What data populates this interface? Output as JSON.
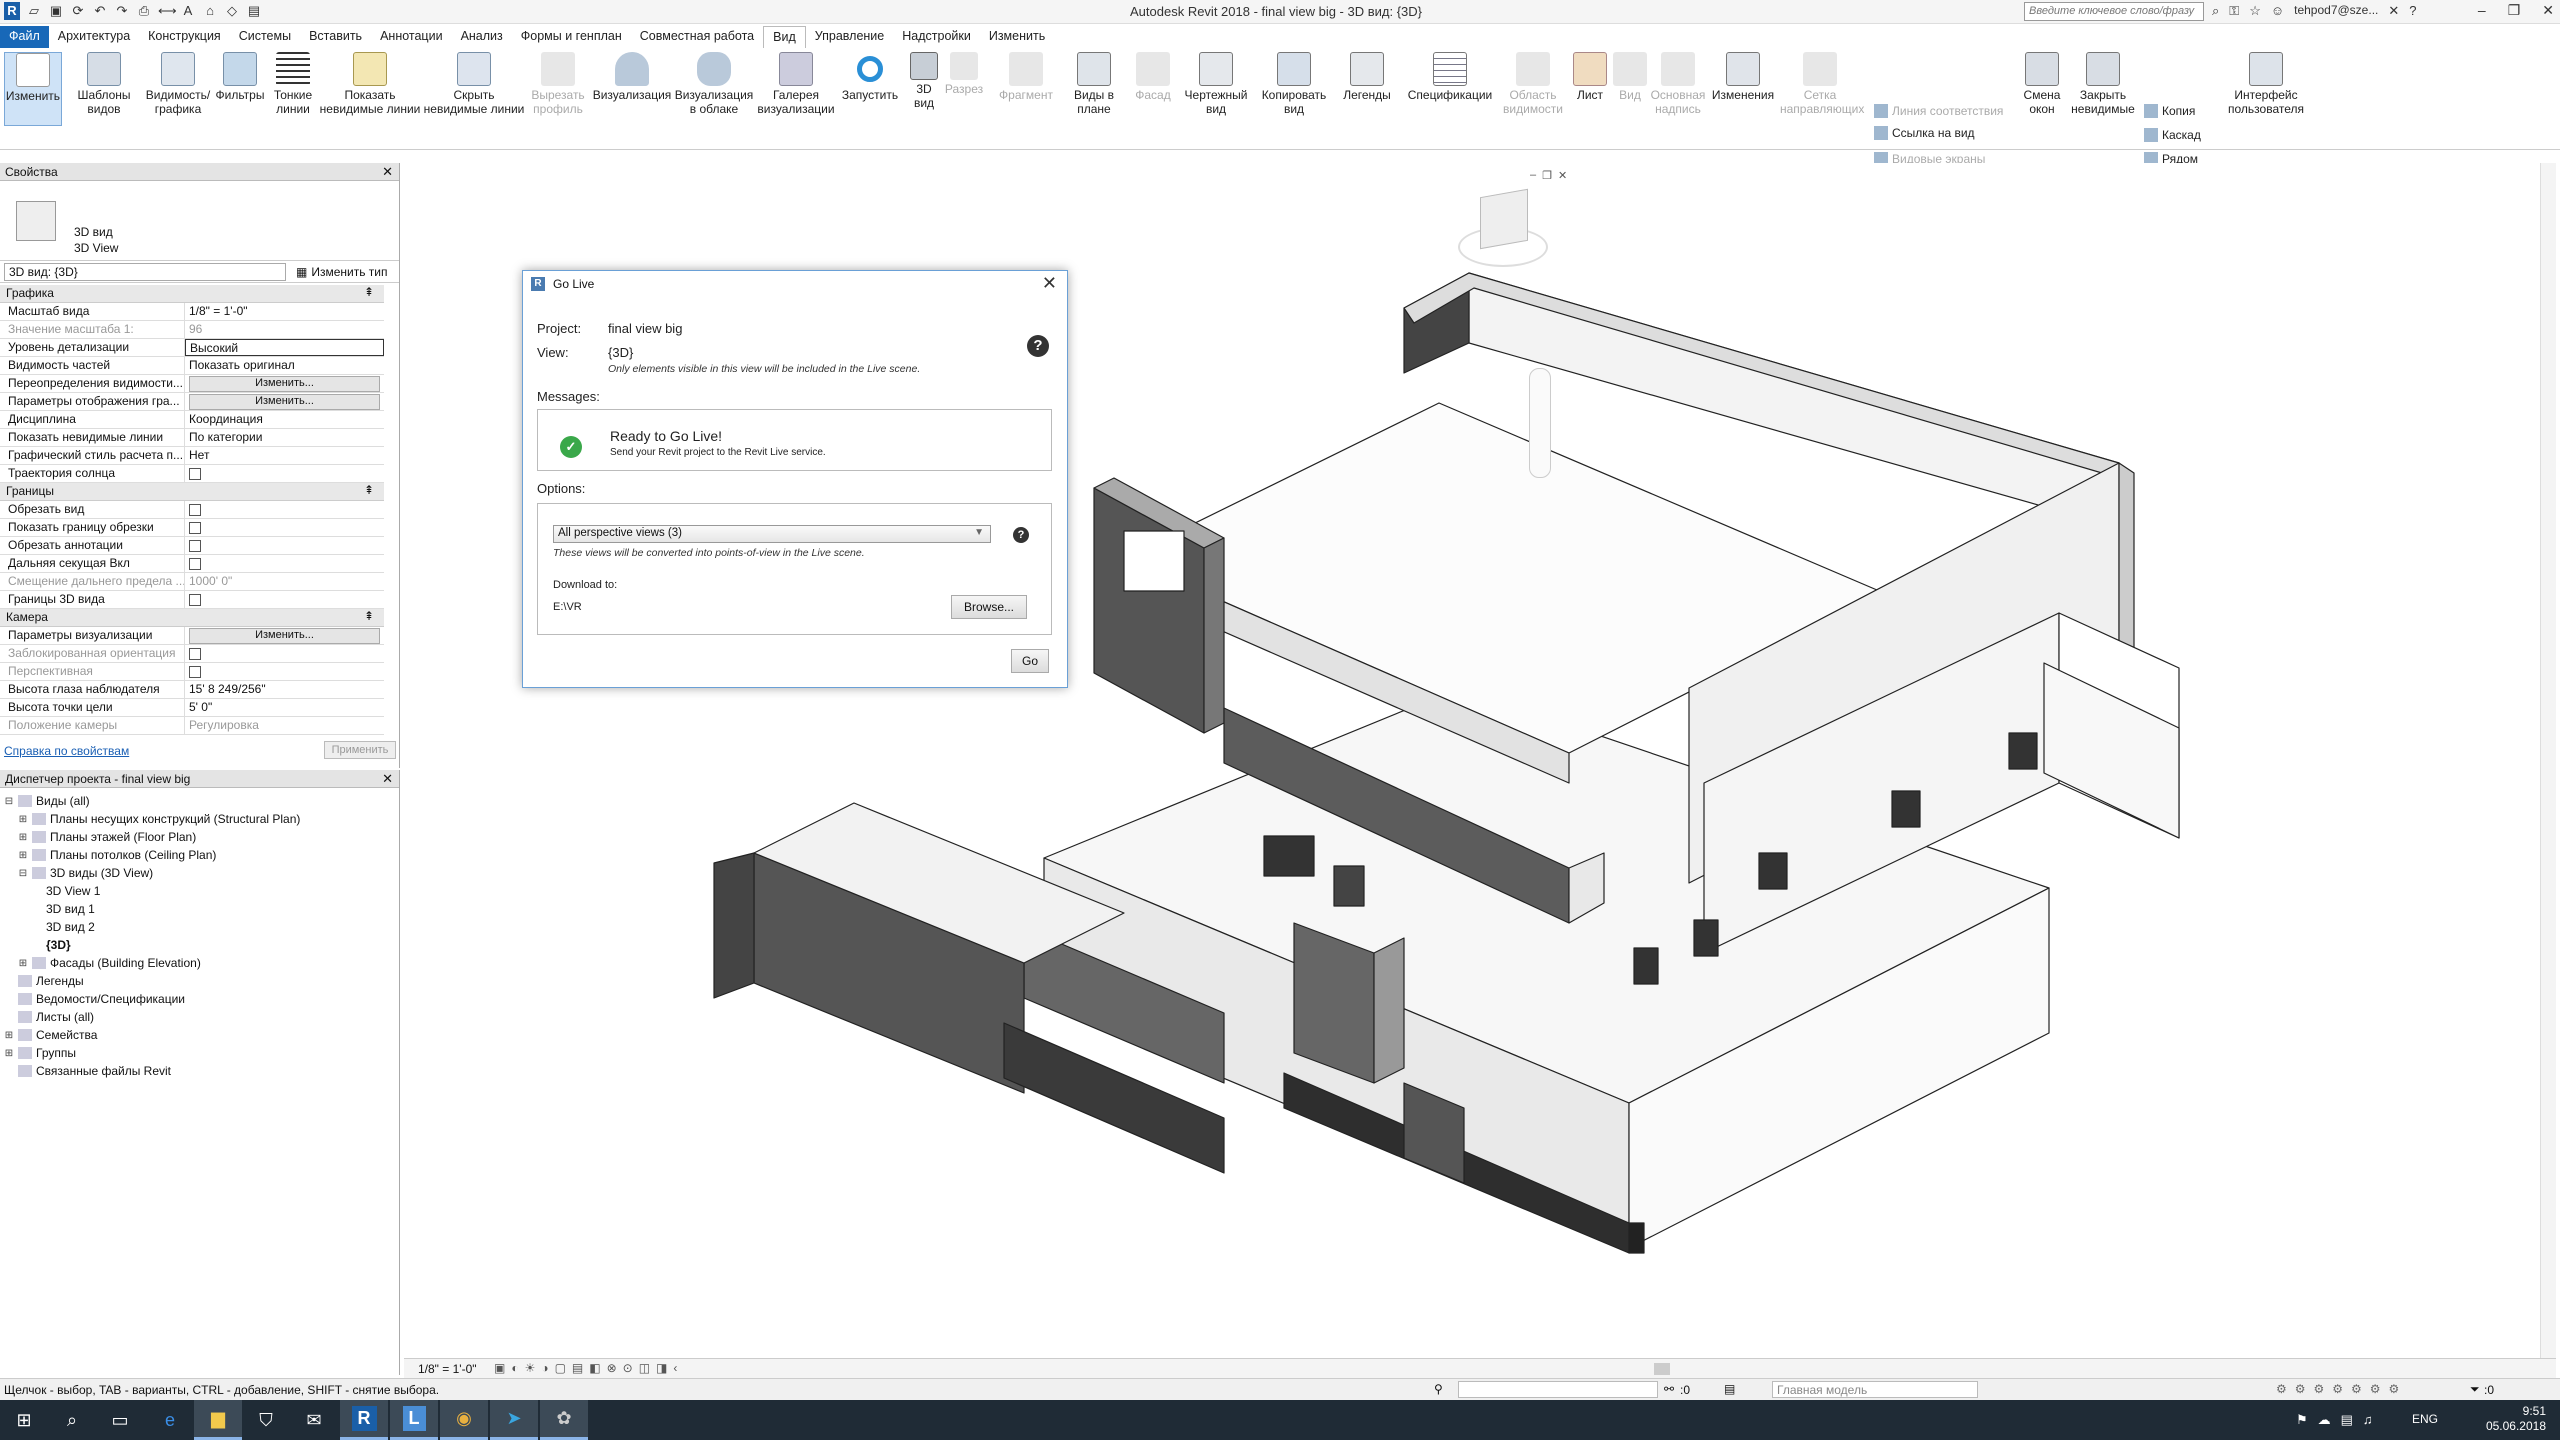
{
  "titlebar": {
    "title": "Autodesk Revit 2018 -   final view big - 3D вид: {3D}",
    "search_placeholder": "Введите ключевое слово/фразу",
    "user": "tehpod7@sze...",
    "qat_icons": [
      "revit-logo-icon",
      "open-icon",
      "save-icon",
      "sync-icon",
      "undo-icon",
      "redo-icon",
      "print-icon",
      "measure-icon",
      "text-icon",
      "3d-view-icon",
      "section-icon",
      "close-hidden-icon"
    ]
  },
  "menu": {
    "tabs": [
      "Файл",
      "Архитектура",
      "Конструкция",
      "Системы",
      "Вставить",
      "Аннотации",
      "Анализ",
      "Формы и генплан",
      "Совместная работа",
      "Вид",
      "Управление",
      "Надстройки",
      "Изменить"
    ],
    "active": "Вид"
  },
  "ribbon": {
    "modify": "Изменить",
    "templates": "Шаблоны видов",
    "visibility": "Видимость/ графика",
    "filters": "Фильтры",
    "thin_lines": "Тонкие линии",
    "show_hidden": "Показать невидимые линии",
    "hide_hidden": "Скрыть невидимые линии",
    "cut_profile": "Вырезать профиль",
    "render": "Визуализация",
    "render_cloud": "Визуализация в облаке",
    "render_gallery": "Галерея визуализации",
    "start": "Запустить",
    "view3d": "3D вид",
    "section": "Разрез",
    "fragment": "Фрагмент",
    "plan_views": "Виды в плане",
    "elevation": "Фасад",
    "drafting": "Чертежный вид",
    "duplicate": "Копировать вид",
    "legends": "Легенды",
    "schedules": "Спецификации",
    "scope_box": "Область видимости",
    "sheet": "Лист",
    "view": "Вид",
    "title_block": "Основная надпись",
    "revisions": "Изменения",
    "guide_grid": "Сетка направляющих",
    "match_line": "Линия соответствия",
    "view_ref": "Ссылка на вид",
    "viewports": "Видовые экраны",
    "switch_windows": "Смена окон",
    "close_hidden": "Закрыть невидимые",
    "copy": "Копия",
    "cascade": "Каскад",
    "tile": "Рядом",
    "ui": "Интерфейс пользователя"
  },
  "properties": {
    "header": "Свойства",
    "type_name1": "3D вид",
    "type_name2": "3D View",
    "type_select": "3D вид: {3D}",
    "edit_type": "Изменить тип",
    "groups": [
      {
        "name": "Графика",
        "rows": [
          {
            "k": "Масштаб вида",
            "v": "1/8\" = 1'-0\"",
            "t": "text"
          },
          {
            "k": "Значение масштаба    1:",
            "v": "96",
            "t": "text",
            "dis": true
          },
          {
            "k": "Уровень детализации",
            "v": "Высокий",
            "t": "text"
          },
          {
            "k": "Видимость частей",
            "v": "Показать оригинал",
            "t": "text"
          },
          {
            "k": "Переопределения видимости...",
            "v": "Изменить...",
            "t": "btn"
          },
          {
            "k": "Параметры отображения гра...",
            "v": "Изменить...",
            "t": "btn"
          },
          {
            "k": "Дисциплина",
            "v": "Координация",
            "t": "text"
          },
          {
            "k": "Показать невидимые линии",
            "v": "По категории",
            "t": "text"
          },
          {
            "k": "Графический стиль расчета п...",
            "v": "Нет",
            "t": "text"
          },
          {
            "k": "Траектория солнца",
            "v": "",
            "t": "cb"
          }
        ]
      },
      {
        "name": "Границы",
        "rows": [
          {
            "k": "Обрезать вид",
            "v": "",
            "t": "cb"
          },
          {
            "k": "Показать границу обрезки",
            "v": "",
            "t": "cb"
          },
          {
            "k": "Обрезать аннотации",
            "v": "",
            "t": "cb"
          },
          {
            "k": "Дальняя секущая Вкл",
            "v": "",
            "t": "cb"
          },
          {
            "k": "Смещение дальнего предела ...",
            "v": "1000'  0\"",
            "t": "text",
            "dis": true
          },
          {
            "k": "Границы 3D вида",
            "v": "",
            "t": "cb"
          }
        ]
      },
      {
        "name": "Камера",
        "rows": [
          {
            "k": "Параметры визуализации",
            "v": "Изменить...",
            "t": "btn"
          },
          {
            "k": "Заблокированная ориентация",
            "v": "",
            "t": "cb",
            "dis": true
          },
          {
            "k": "Перспективная",
            "v": "",
            "t": "cb",
            "dis": true
          },
          {
            "k": "Высота глаза наблюдателя",
            "v": "15'  8 249/256\"",
            "t": "text"
          },
          {
            "k": "Высота точки цели",
            "v": "5'  0\"",
            "t": "text"
          },
          {
            "k": "Положение камеры",
            "v": "Регулировка",
            "t": "text",
            "dis": true
          }
        ]
      }
    ],
    "help_link": "Справка по свойствам",
    "apply": "Применить"
  },
  "browser": {
    "header": "Диспетчер проекта - final view big",
    "nodes": [
      {
        "label": "Виды (all)",
        "depth": 0,
        "tg": "⊟"
      },
      {
        "label": "Планы несущих конструкций (Structural Plan)",
        "depth": 1,
        "tg": "⊞"
      },
      {
        "label": "Планы этажей (Floor Plan)",
        "depth": 1,
        "tg": "⊞"
      },
      {
        "label": "Планы потолков (Ceiling Plan)",
        "depth": 1,
        "tg": "⊞"
      },
      {
        "label": "3D виды (3D View)",
        "depth": 1,
        "tg": "⊟"
      },
      {
        "label": "3D View 1",
        "depth": 2,
        "tg": ""
      },
      {
        "label": "3D вид 1",
        "depth": 2,
        "tg": ""
      },
      {
        "label": "3D вид 2",
        "depth": 2,
        "tg": ""
      },
      {
        "label": "{3D}",
        "depth": 2,
        "tg": "",
        "bold": true
      },
      {
        "label": "Фасады (Building Elevation)",
        "depth": 1,
        "tg": "⊞"
      },
      {
        "label": "Легенды",
        "depth": 0,
        "tg": ""
      },
      {
        "label": "Ведомости/Спецификации",
        "depth": 0,
        "tg": ""
      },
      {
        "label": "Листы (all)",
        "depth": 0,
        "tg": ""
      },
      {
        "label": "Семейства",
        "depth": 0,
        "tg": "⊞"
      },
      {
        "label": "Группы",
        "depth": 0,
        "tg": "⊞"
      },
      {
        "label": "Связанные файлы Revit",
        "depth": 0,
        "tg": ""
      }
    ]
  },
  "dialog": {
    "title": "Go Live",
    "project_label": "Project:",
    "project_value": "final view big",
    "view_label": "View:",
    "view_value": "{3D}",
    "view_note": "Only elements visible in this view will be included in the Live scene.",
    "messages_label": "Messages:",
    "status_title": "Ready to Go Live!",
    "status_sub": "Send your Revit project to the Revit Live service.",
    "options_label": "Options:",
    "option_select": "All perspective views (3)",
    "option_note": "These views will be converted into points-of-view in the Live scene.",
    "download_label": "Download to:",
    "download_path": "E:\\VR",
    "browse": "Browse...",
    "go": "Go"
  },
  "viewstrip": {
    "scale": "1/8\" = 1'-0\""
  },
  "status": {
    "hint": "Щелчок - выбор, TAB - варианты, CTRL - добавление, SHIFT - снятие выбора.",
    "zero": ":0",
    "model": "Главная модель",
    "filter_count": ":0"
  },
  "taskbar": {
    "lang": "ENG",
    "time": "9:51",
    "date": "05.06.2018"
  }
}
